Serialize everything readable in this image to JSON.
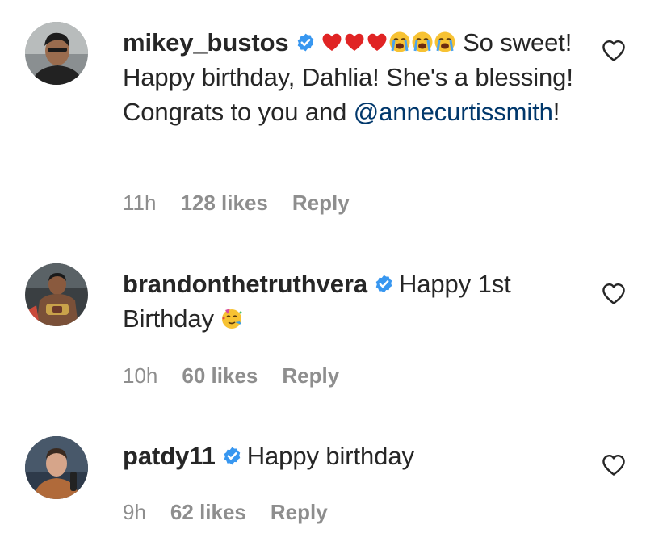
{
  "comments": [
    {
      "username": "mikey_bustos",
      "verified": true,
      "emojis": [
        "red-heart",
        "red-heart",
        "red-heart",
        "loudly-crying-face",
        "loudly-crying-face",
        "loudly-crying-face"
      ],
      "text_part1": " So sweet! Happy birthday, Dahlia! She's a blessing! Congrats to you and ",
      "mention": "@annecurtissmith",
      "text_part2": "!",
      "time": "11h",
      "likes": "128 likes",
      "reply": "Reply"
    },
    {
      "username": "brandonthetruthvera",
      "verified": true,
      "text": "Happy 1st Birthday ",
      "emoji": "partying-face",
      "time": "10h",
      "likes": "60 likes",
      "reply": "Reply"
    },
    {
      "username": "patdy11",
      "verified": true,
      "text": "Happy birthday",
      "time": "9h",
      "likes": "62 likes",
      "reply": "Reply"
    }
  ],
  "colors": {
    "verified_badge": "#3897f0",
    "mention": "#00376b",
    "meta_text": "#8e8e8e",
    "primary_text": "#262626"
  }
}
